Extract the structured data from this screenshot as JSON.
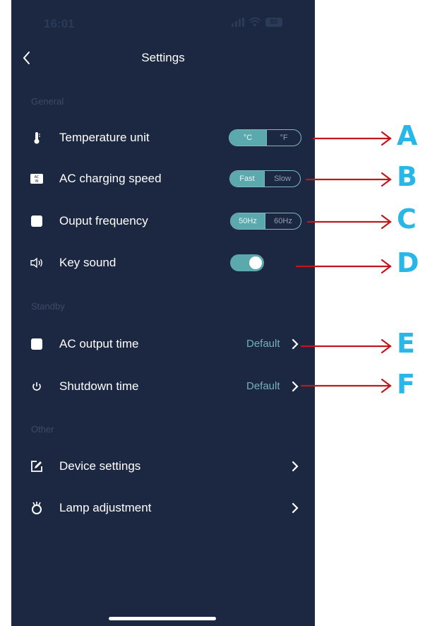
{
  "status_bar": {
    "time": "16:01",
    "battery": "80"
  },
  "header": {
    "title": "Settings"
  },
  "sections": {
    "general": "General",
    "standby": "Standby",
    "other": "Other"
  },
  "rows": {
    "temperature_unit": {
      "label": "Temperature unit",
      "options": [
        "°C",
        "°F"
      ],
      "selected": "°C",
      "icon": "thermometer-icon"
    },
    "ac_charging_speed": {
      "label": "AC charging speed",
      "options": [
        "Fast",
        "Slow"
      ],
      "selected": "Fast",
      "icon": "ac-in-icon"
    },
    "output_frequency": {
      "label": "Ouput frequency",
      "options": [
        "50Hz",
        "60Hz"
      ],
      "selected": "50Hz",
      "icon": "square-icon"
    },
    "key_sound": {
      "label": "Key sound",
      "enabled": true,
      "icon": "speaker-icon"
    },
    "ac_output_time": {
      "label": "AC output time",
      "value": "Default",
      "icon": "square-icon"
    },
    "shutdown_time": {
      "label": "Shutdown time",
      "value": "Default",
      "icon": "power-icon"
    },
    "device_settings": {
      "label": "Device settings",
      "icon": "edit-icon"
    },
    "lamp_adjustment": {
      "label": "Lamp adjustment",
      "icon": "lamp-icon"
    }
  },
  "annotations": [
    "A",
    "B",
    "C",
    "D",
    "E",
    "F"
  ],
  "colors": {
    "background": "#1c2841",
    "accent": "#5ba8ad",
    "annotation_arrow": "#c0161c",
    "annotation_letter": "#29b7e8"
  }
}
